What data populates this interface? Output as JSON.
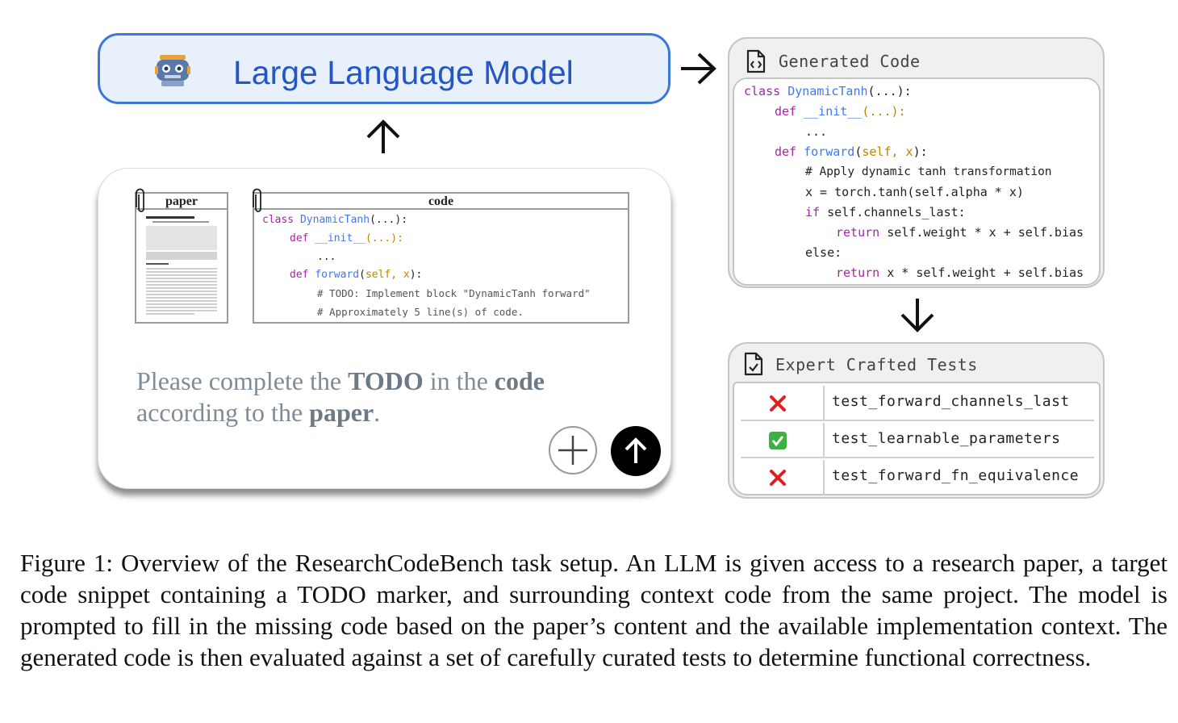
{
  "llm": {
    "title": "Large Language Model",
    "icon": "robot-icon"
  },
  "prompt_card": {
    "paper_label": "paper",
    "code_label": "code",
    "code_lines": [
      [
        "class ",
        "DynamicTanh",
        "(...):"
      ],
      [
        "def ",
        "__init__",
        "(...):"
      ],
      [
        "..."
      ],
      [
        "def ",
        "forward",
        "(",
        "self, x",
        "):"
      ],
      [
        "# TODO: Implement block \"DynamicTanh forward\""
      ],
      [
        "# Approximately 5 line(s) of code."
      ]
    ],
    "prompt_parts": {
      "p1": "Please complete the ",
      "todo": "TODO",
      "p2": " in the ",
      "code": "code",
      "p3": "according to the ",
      "paper": "paper",
      "p4": "."
    },
    "plus_icon": "plus-icon",
    "send_icon": "arrow-up-icon"
  },
  "generated_code": {
    "title": "Generated Code",
    "icon": "code-file-icon",
    "lines": {
      "l1": [
        "class ",
        "DynamicTanh",
        "(...):"
      ],
      "l2": [
        "def ",
        "__init__",
        "(...):"
      ],
      "l3": "...",
      "l4": [
        "def ",
        "forward",
        "(",
        "self, x",
        "):"
      ],
      "l5": "# Apply dynamic tanh transformation",
      "l6": "x = torch.tanh(self.alpha * x)",
      "l7": [
        "if ",
        "self.channels_last:"
      ],
      "l8": [
        "return ",
        "self.weight * x + self.bias"
      ],
      "l9": "else:",
      "l10": [
        "return ",
        "x * self.weight + self.bias"
      ]
    }
  },
  "tests": {
    "title": "Expert Crafted Tests",
    "icon": "checked-file-icon",
    "rows": [
      {
        "name": "test_forward_channels_last",
        "status": "fail"
      },
      {
        "name": "test_learnable_parameters",
        "status": "pass"
      },
      {
        "name": "test_forward_fn_equivalence",
        "status": "fail"
      }
    ]
  },
  "caption": "Figure 1: Overview of the ResearchCodeBench task setup. An LLM is given access to a research paper, a target code snippet containing a TODO marker, and surrounding context code from the same project. The model is prompted to fill in the missing code based on the paper’s content and the available implementation context. The generated code is then evaluated against a set of carefully curated tests to determine functional correctness.",
  "colors": {
    "llm_border": "#3b78d8",
    "llm_fill": "#e8f0fc",
    "llm_text": "#2456c6",
    "keyword": "#a626a4",
    "function": "#4078f2",
    "param": "#c18401",
    "fail": "#e02020",
    "pass": "#3cb043"
  }
}
